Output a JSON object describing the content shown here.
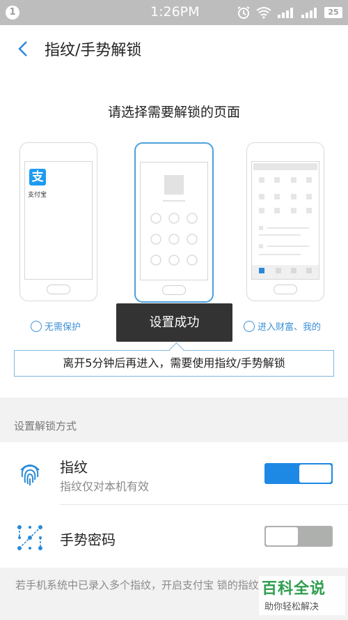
{
  "status_bar": {
    "notification_count": "1",
    "time": "1:26PM",
    "battery": "25"
  },
  "header": {
    "title": "指纹/手势解锁"
  },
  "select": {
    "title": "请选择需要解锁的页面",
    "options": [
      {
        "label": "无需保护",
        "selected": false
      },
      {
        "label": "",
        "selected": true
      },
      {
        "label": "进入财富、我的",
        "selected": false
      }
    ],
    "alipay_name": "支付宝",
    "alipay_logo_char": "支"
  },
  "toast": "设置成功",
  "notice": "离开5分钟后再进入，需要使用指纹/手势解锁",
  "section": {
    "label": "设置解锁方式"
  },
  "methods": [
    {
      "title": "指纹",
      "subtitle": "指纹仅对本机有效",
      "enabled": true,
      "icon": "fingerprint-icon"
    },
    {
      "title": "手势密码",
      "subtitle": "",
      "enabled": false,
      "icon": "gesture-icon"
    }
  ],
  "footer": "若手机系统中已录入多个指纹，开启支付宝 锁的指纹",
  "watermark": {
    "big": "百科全说",
    "small": "助你轻松解决"
  },
  "colors": {
    "accent": "#1e88e5",
    "status_bar": "#bdbdbd",
    "toast_bg": "#333333",
    "watermark_green": "#2e9e4d"
  }
}
